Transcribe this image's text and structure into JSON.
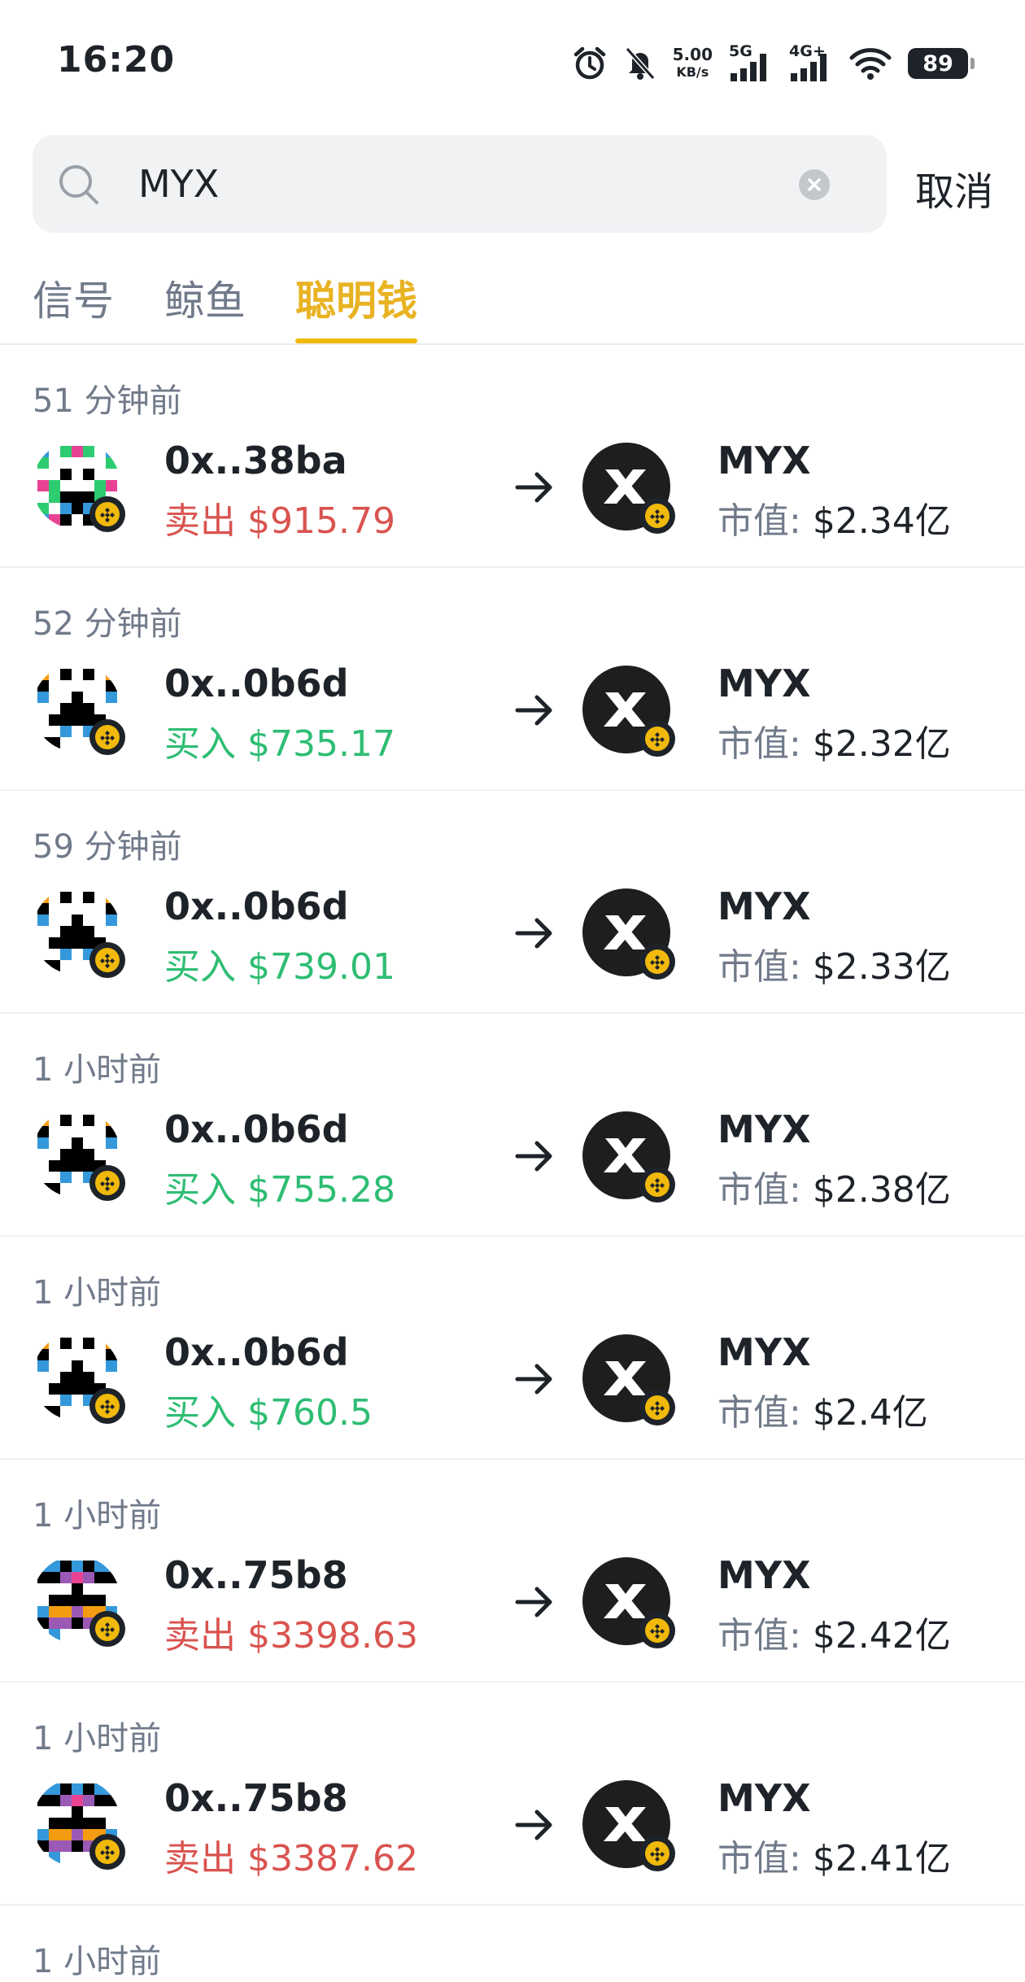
{
  "status_bar": {
    "time": "16:20",
    "net_speed_value": "5.00",
    "net_speed_unit": "KB/s",
    "sig1": "5G",
    "sig2": "4G+",
    "battery": "89"
  },
  "search": {
    "value": "MYX",
    "cancel_label": "取消"
  },
  "tabs": [
    {
      "label": "信号",
      "active": false
    },
    {
      "label": "鲸鱼",
      "active": false
    },
    {
      "label": "聪明钱",
      "active": true
    }
  ],
  "colors": {
    "accent": "#f0b90b",
    "sell": "#d9534f",
    "buy": "#2ebd73"
  },
  "mcap_label": "市值: ",
  "rows": [
    {
      "time": "51 分钟前",
      "address": "0x..38ba",
      "action": "卖出",
      "side": "sell",
      "amount": "$915.79",
      "token": "MYX",
      "mcap": "$2.34亿"
    },
    {
      "time": "52 分钟前",
      "address": "0x..0b6d",
      "action": "买入",
      "side": "buy",
      "amount": "$735.17",
      "token": "MYX",
      "mcap": "$2.32亿"
    },
    {
      "time": "59 分钟前",
      "address": "0x..0b6d",
      "action": "买入",
      "side": "buy",
      "amount": "$739.01",
      "token": "MYX",
      "mcap": "$2.33亿"
    },
    {
      "time": "1 小时前",
      "address": "0x..0b6d",
      "action": "买入",
      "side": "buy",
      "amount": "$755.28",
      "token": "MYX",
      "mcap": "$2.38亿"
    },
    {
      "time": "1 小时前",
      "address": "0x..0b6d",
      "action": "买入",
      "side": "buy",
      "amount": "$760.5",
      "token": "MYX",
      "mcap": "$2.4亿"
    },
    {
      "time": "1 小时前",
      "address": "0x..75b8",
      "action": "卖出",
      "side": "sell",
      "amount": "$3398.63",
      "token": "MYX",
      "mcap": "$2.42亿"
    },
    {
      "time": "1 小时前",
      "address": "0x..75b8",
      "action": "卖出",
      "side": "sell",
      "amount": "$3387.62",
      "token": "MYX",
      "mcap": "$2.41亿"
    }
  ],
  "partial_row_time": "1 小时前"
}
